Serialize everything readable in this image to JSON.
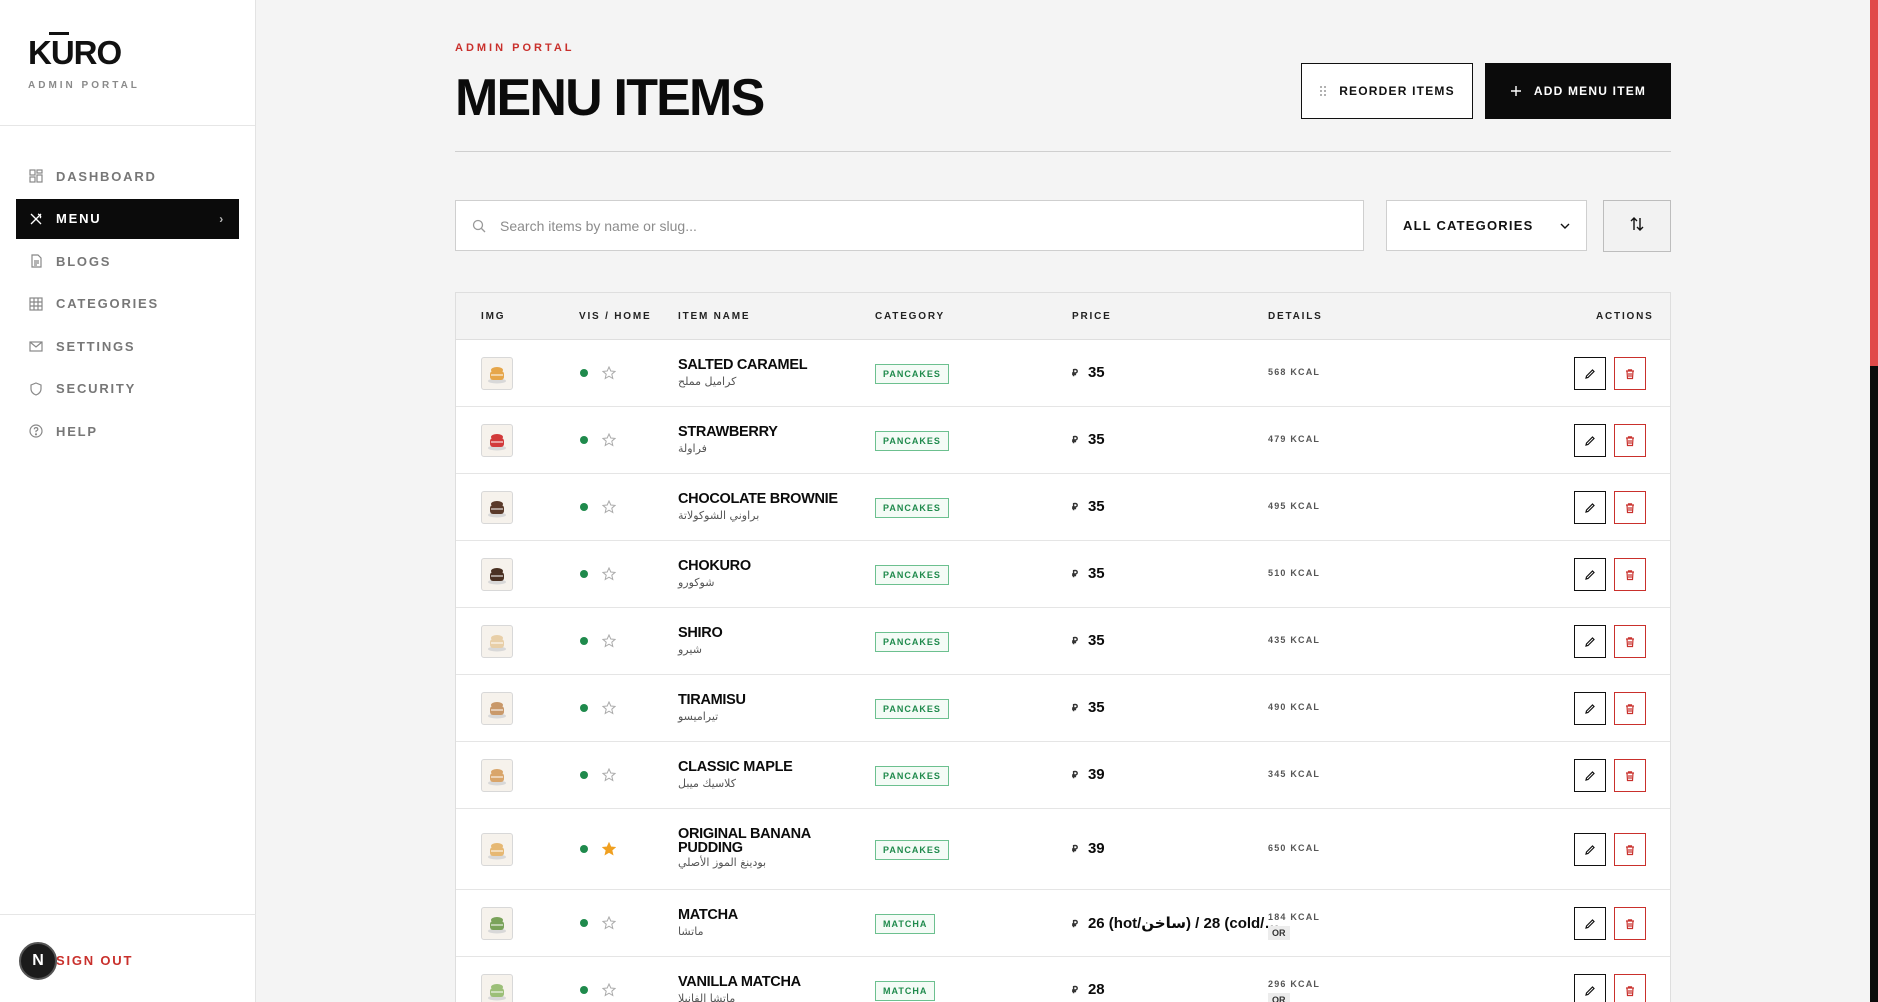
{
  "brand": {
    "logo": "KURO",
    "subtitle": "ADMIN PORTAL"
  },
  "sidebar": {
    "items": [
      {
        "label": "DASHBOARD",
        "icon": "dashboard-icon"
      },
      {
        "label": "MENU",
        "icon": "utensils-icon",
        "active": true
      },
      {
        "label": "BLOGS",
        "icon": "document-icon"
      },
      {
        "label": "CATEGORIES",
        "icon": "grid-icon"
      },
      {
        "label": "SETTINGS",
        "icon": "mail-icon"
      },
      {
        "label": "SECURITY",
        "icon": "shield-icon"
      },
      {
        "label": "HELP",
        "icon": "help-icon"
      }
    ],
    "signout": "SIGN OUT",
    "avatar": "N"
  },
  "header": {
    "eyebrow": "ADMIN PORTAL",
    "title": "MENU ITEMS",
    "reorder_label": "REORDER ITEMS",
    "add_label": "ADD MENU ITEM"
  },
  "filters": {
    "search_placeholder": "Search items by name or slug...",
    "category_selected": "ALL CATEGORIES"
  },
  "table": {
    "headers": {
      "img": "IMG",
      "vis": "VIS / HOME",
      "name": "ITEM NAME",
      "category": "CATEGORY",
      "price": "PRICE",
      "details": "DETAILS",
      "actions": "ACTIONS"
    },
    "currency_symbol": "⃁",
    "rows": [
      {
        "name": "SALTED CARAMEL",
        "name_ar": "كراميل مملح",
        "category": "PANCAKES",
        "price": "35",
        "kcal": "568 KCAL",
        "home": false,
        "thumb_color": "#e6a64a"
      },
      {
        "name": "STRAWBERRY",
        "name_ar": "فراولة",
        "category": "PANCAKES",
        "price": "35",
        "kcal": "479 KCAL",
        "home": false,
        "thumb_color": "#d23a3a"
      },
      {
        "name": "CHOCOLATE BROWNIE",
        "name_ar": "براوني الشوكولاتة",
        "category": "PANCAKES",
        "price": "35",
        "kcal": "495 KCAL",
        "home": false,
        "thumb_color": "#5a3a2a"
      },
      {
        "name": "CHOKURO",
        "name_ar": "شوكورو",
        "category": "PANCAKES",
        "price": "35",
        "kcal": "510 KCAL",
        "home": false,
        "thumb_color": "#4a3022"
      },
      {
        "name": "SHIRO",
        "name_ar": "شيرو",
        "category": "PANCAKES",
        "price": "35",
        "kcal": "435 KCAL",
        "home": false,
        "thumb_color": "#e8cfa8"
      },
      {
        "name": "TIRAMISU",
        "name_ar": "تيراميسو",
        "category": "PANCAKES",
        "price": "35",
        "kcal": "490 KCAL",
        "home": false,
        "thumb_color": "#c9996a"
      },
      {
        "name": "CLASSIC MAPLE",
        "name_ar": "كلاسيك ميبل",
        "category": "PANCAKES",
        "price": "39",
        "kcal": "345 KCAL",
        "home": false,
        "thumb_color": "#d9a56a"
      },
      {
        "name": "ORIGINAL BANANA PUDDING",
        "name_ar": "بودينغ الموز الأصلي",
        "category": "PANCAKES",
        "price": "39",
        "kcal": "650 KCAL",
        "home": true,
        "thumb_color": "#e6b873"
      },
      {
        "name": "MATCHA",
        "name_ar": "ماتشا",
        "category": "MATCHA",
        "price": "26 (hot/ساخن) / 28 (cold/…",
        "kcal": "184 KCAL",
        "or": "OR",
        "home": false,
        "thumb_color": "#7aa35a"
      },
      {
        "name": "VANILLA MATCHA",
        "name_ar": "ماتشا الفانيلا",
        "category": "MATCHA",
        "price": "28",
        "kcal": "296 KCAL",
        "or": "OR",
        "home": false,
        "thumb_color": "#9cbf78"
      }
    ]
  },
  "colors": {
    "accent": "#c9302c",
    "dark": "#0b0b0b",
    "visible_dot": "#1f8a4c",
    "home_star": "#f0a020"
  }
}
